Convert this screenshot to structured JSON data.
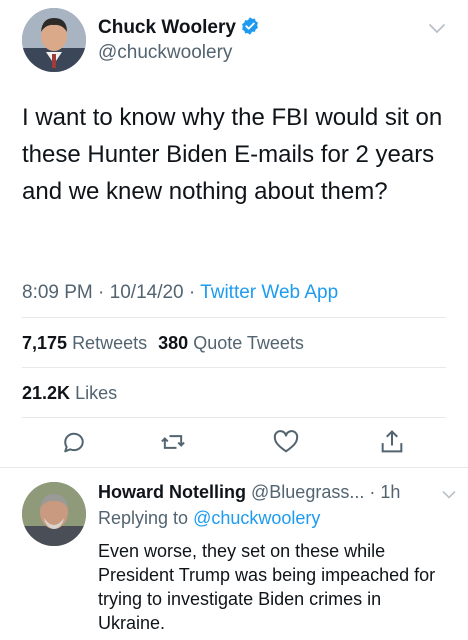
{
  "tweet": {
    "author_name": "Chuck Woolery",
    "author_handle": "@chuckwoolery",
    "text": "I want to know why the FBI would sit on these Hunter Biden E-mails for 2 years and we knew nothing about them?",
    "time": "8:09 PM",
    "date": "10/14/20",
    "source": "Twitter Web App",
    "separator": "·",
    "retweets_count": "7,175",
    "retweets_label": "Retweets",
    "quote_count": "380",
    "quote_label": "Quote Tweets",
    "likes_count": "21.2K",
    "likes_label": "Likes"
  },
  "reply": {
    "author_name": "Howard Notelling",
    "author_handle": "@Bluegrass...",
    "time_ago": "1h",
    "replying_label": "Replying to",
    "replying_handle": "@chuckwoolery",
    "text": "Even worse, they set on these while President Trump was being impeached for trying to investigate Biden crimes in Ukraine."
  },
  "colors": {
    "accent": "#1d9bf0",
    "text": "#0f1419",
    "secondary": "#536471"
  },
  "icons": [
    "verified-badge-icon",
    "chevron-down-icon",
    "reply-icon",
    "retweet-icon",
    "like-icon",
    "share-icon"
  ]
}
